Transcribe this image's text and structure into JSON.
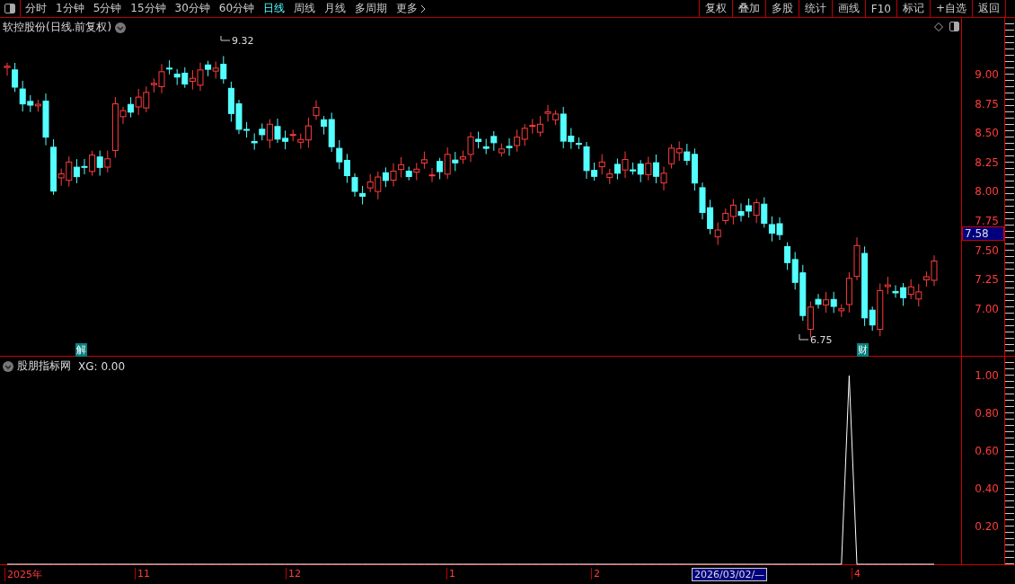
{
  "toolbar": {
    "periods": [
      {
        "label": "分时",
        "selected": false
      },
      {
        "label": "1分钟",
        "selected": false
      },
      {
        "label": "5分钟",
        "selected": false
      },
      {
        "label": "15分钟",
        "selected": false
      },
      {
        "label": "30分钟",
        "selected": false
      },
      {
        "label": "60分钟",
        "selected": false
      },
      {
        "label": "日线",
        "selected": true
      },
      {
        "label": "周线",
        "selected": false
      },
      {
        "label": "月线",
        "selected": false
      },
      {
        "label": "多周期",
        "selected": false
      },
      {
        "label": "更多",
        "selected": false
      }
    ],
    "buttons": [
      "复权",
      "叠加",
      "多股",
      "统计",
      "画线",
      "F10",
      "标记",
      "+自选",
      "返回"
    ]
  },
  "main_chart": {
    "title": "软控股份(日线.前复权)",
    "y_labels": [
      "9.00",
      "8.75",
      "8.50",
      "8.25",
      "8.00",
      "7.75",
      "7.50",
      "7.25",
      "7.00"
    ],
    "current_price": "7.58",
    "high_marker": "9.32",
    "low_marker": "6.75",
    "event_badges": [
      "解",
      "财"
    ]
  },
  "indicator": {
    "name": "股朋指标网",
    "reading": "XG: 0.00",
    "y_labels": [
      "1.00",
      "0.80",
      "0.60",
      "0.40",
      "0.20"
    ]
  },
  "date_axis": {
    "labels": [
      {
        "label": "2025年",
        "selected": false
      },
      {
        "label": "11",
        "selected": false
      },
      {
        "label": "12",
        "selected": false
      },
      {
        "label": "1",
        "selected": false
      },
      {
        "label": "2",
        "selected": false
      },
      {
        "label": "2026/03/02/—",
        "selected": true
      },
      {
        "label": "4",
        "selected": false
      }
    ]
  }
}
